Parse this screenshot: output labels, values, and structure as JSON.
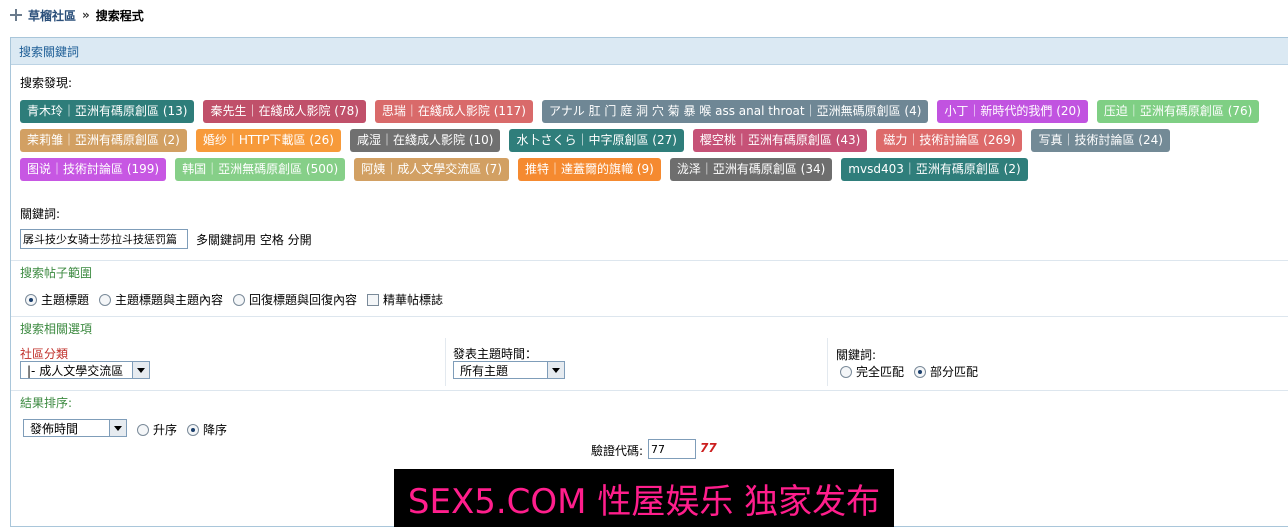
{
  "breadcrumb": {
    "home": "草榴社區",
    "separator": "»",
    "current": "搜索程式"
  },
  "panel": {
    "title": "搜索關鍵詞",
    "found_label": "搜索發現:",
    "tag_rows": [
      [
        {
          "text": "青木玲｜亞洲有碼原創區 (13)",
          "color": "#2e7d7a"
        },
        {
          "text": "秦先生｜在綫成人影院 (78)",
          "color": "#c0506a"
        },
        {
          "text": "思瑞｜在綫成人影院 (117)",
          "color": "#d96a6a"
        },
        {
          "text": "アナル 肛 门 庭 洞 穴 菊 暴 喉 ass anal throat｜亞洲無碼原創區 (4)",
          "color": "#6f8795"
        },
        {
          "text": "小丁｜新時代的我們 (20)",
          "color": "#c153e0"
        },
        {
          "text": "压迫｜亞洲有碼原創區 (76)",
          "color": "#7fcf84"
        }
      ],
      [
        {
          "text": "茉莉雏｜亞洲有碼原創區 (2)",
          "color": "#d2a063"
        },
        {
          "text": "婚纱｜HTTP下載區 (26)",
          "color": "#f79a3a"
        },
        {
          "text": "咸湿｜在綫成人影院 (10)",
          "color": "#707070"
        },
        {
          "text": "水卜さくら｜中字原創區 (27)",
          "color": "#2f7e7b"
        },
        {
          "text": "樱空桃｜亞洲有碼原創區 (43)",
          "color": "#c65277"
        },
        {
          "text": "磁力｜技術討論區 (269)",
          "color": "#dd6a6a"
        },
        {
          "text": "写真｜技術討論區 (24)",
          "color": "#738a96"
        }
      ],
      [
        {
          "text": "图说｜技術討論區 (199)",
          "color": "#c757e3"
        },
        {
          "text": "韩国｜亞洲無碼原創區 (500)",
          "color": "#86cf88"
        },
        {
          "text": "阿姨｜成人文學交流區 (7)",
          "color": "#d2a063"
        },
        {
          "text": "推特｜達蓋爾的旗幟 (9)",
          "color": "#f58a30"
        },
        {
          "text": "泷泽｜亞洲有碼原創區 (34)",
          "color": "#6e6e6e"
        },
        {
          "text": "mvsd403｜亞洲有碼原創區 (2)",
          "color": "#2f7e7b"
        }
      ]
    ],
    "keyword_label": "關鍵詞:",
    "keyword_value": "孱斗技少女骑士莎拉斗技惩罚篇",
    "keyword_hint": "多關鍵詞用 空格 分開",
    "scope": {
      "title": "搜索帖子範圍",
      "options": [
        "主題標題",
        "主題標題與主題內容",
        "回復標題與回復內容"
      ],
      "selected": 0,
      "digest_label": "精華帖標誌"
    },
    "related": {
      "title": "搜索相關選項",
      "forum_label": "社區分類",
      "forum_value": "|- 成人文學交流區",
      "time_label": "發表主題時間：",
      "time_value": "所有主題",
      "match_label": "關鍵詞:",
      "match_options": [
        "完全匹配",
        "部分匹配"
      ],
      "match_selected": 1
    },
    "sort": {
      "title": "結果排序:",
      "field_value": "發佈時間",
      "order_options": [
        "升序",
        "降序"
      ],
      "order_selected": 1
    },
    "captcha": {
      "label": "驗證代碼:",
      "value": "77",
      "code": "77"
    }
  },
  "banner": {
    "text": "SEX5.COM 性屋娱乐 独家发布"
  }
}
